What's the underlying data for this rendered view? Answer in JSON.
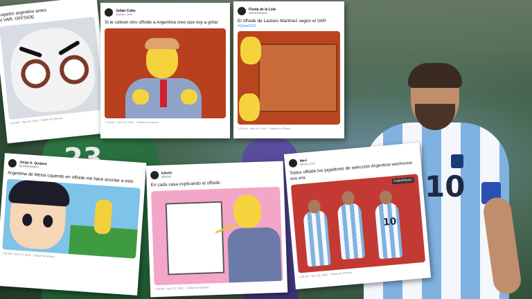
{
  "cards": [
    {
      "name": "",
      "handle": "",
      "text": "Jugador argentino antes\nel VAR: OFFSIDE",
      "footer": "7:28 AM · Nov 22, 2022 · Twitter for iPhone"
    },
    {
      "name": "Julián Cobo",
      "handle": "@julian_cobo",
      "text": "Si le cobran otro offside a Argentina creo que voy a gritar",
      "footer": "7:28 AM · Nov 22, 2022 · Twitter for Android"
    },
    {
      "name": "Fiesta de la Lola",
      "handle": "@fiestadelalola",
      "text": "El offside de Lautaro Martínez según el VAR",
      "hashtag": "#Qatar2022",
      "footer": "7:28 AM · Nov 22, 2022 · Twitter for iPhone"
    },
    {
      "name": "Jorge A. Quijano",
      "handle": "@JorgeQuijano",
      "text": "Argentina de Messi cayendo en offside me hace acordar a esto",
      "footer": "7:28 AM · Nov 22, 2022 · Twitter for iPhone"
    },
    {
      "name": "Kilosh",
      "handle": "@kilosh",
      "text": "En cada casa explicando el offside.",
      "footer": "7:28 AM · Nov 22, 2022 · Twitter for Android"
    },
    {
      "name": "Meri",
      "handle": "@meri_cruz",
      "text": "Todos offside los jugadores de selección Argentina wachoooe sos vos",
      "sticker": "FutbolNews",
      "footer": "7:28 AM · Nov 22, 2022 · Twitter for iPhone"
    }
  ],
  "background": {
    "shirt_number_left": "23",
    "shirt_number_messi": "10"
  },
  "card_images": {
    "card6_player_numbers": [
      "10"
    ]
  }
}
